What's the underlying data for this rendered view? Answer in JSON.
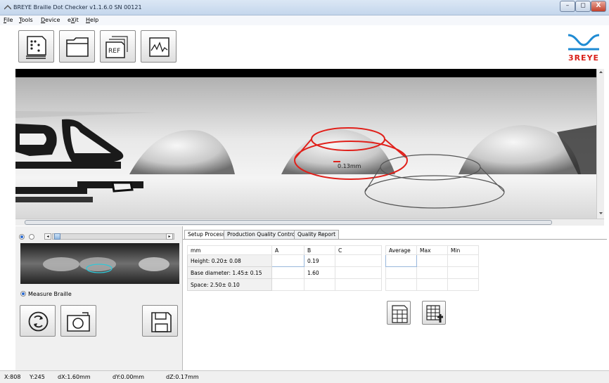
{
  "window": {
    "title": "BREYE Braille Dot Checker v1.1.6.0 SN 00121",
    "controls": [
      "–",
      "◻",
      "X"
    ]
  },
  "menu": {
    "items": [
      {
        "pre": "",
        "ul": "F",
        "post": "ile"
      },
      {
        "pre": "",
        "ul": "T",
        "post": "ools"
      },
      {
        "pre": "",
        "ul": "D",
        "post": "evice"
      },
      {
        "pre": "e",
        "ul": "X",
        "post": "it"
      },
      {
        "pre": "",
        "ul": "H",
        "post": "elp"
      }
    ]
  },
  "toolbar": {
    "ref_label": "REF"
  },
  "logo": {
    "text": "3REYE",
    "colors": {
      "wave": "#1f8bd3",
      "text": "#d8201a"
    }
  },
  "viewer": {
    "measurement_label": "0.13mm"
  },
  "left_panel": {
    "measure_option_label": "Measure Braille"
  },
  "tabs": [
    {
      "label": "Setup Process",
      "active": true
    },
    {
      "label": "Production Quality Control",
      "active": false
    },
    {
      "label": "Quality Report",
      "active": false
    }
  ],
  "measure_table": {
    "headers": [
      "mm",
      "A",
      "B",
      "C"
    ],
    "rows": [
      {
        "label": "Height: 0.20± 0.08",
        "A": "",
        "B": "0.19",
        "C": ""
      },
      {
        "label": "Base diameter: 1.45± 0.15",
        "A": "",
        "B": "1.60",
        "C": ""
      },
      {
        "label": "Space: 2.50± 0.10",
        "A": "",
        "B": "",
        "C": ""
      }
    ]
  },
  "stats_table": {
    "headers": [
      "Average",
      "Max",
      "Min"
    ]
  },
  "status": {
    "x": "X:808",
    "y": "Y:245",
    "dx": "dX:1.60mm",
    "dy": "dY:0.00mm",
    "dz": "dZ:0.17mm"
  }
}
